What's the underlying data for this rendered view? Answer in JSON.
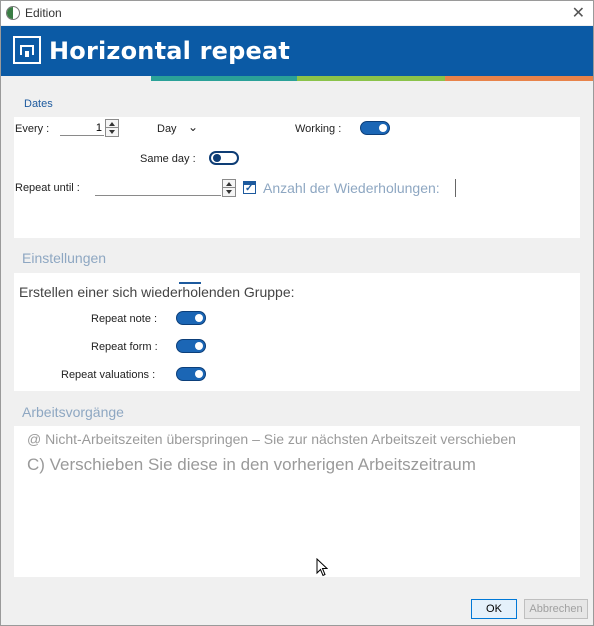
{
  "window": {
    "title": "Edition",
    "close_glyph": "✕"
  },
  "banner": {
    "title": "Horizontal repeat",
    "logo_icon": "frame-logo-icon",
    "color": "#0b5aa5"
  },
  "stripes": [
    "#2aa198",
    "#8bc34a",
    "#9ccc65",
    "#e8834a"
  ],
  "dates": {
    "section_label": "Dates",
    "every_label": "Every :",
    "every_value": "1",
    "unit_value": "Day",
    "unit_chevron": "⌄",
    "working_label": "Working :",
    "same_day_label": "Same day :",
    "repeat_until_label": "Repeat until :",
    "repeat_until_value": "",
    "count_label": "Anzahl der Wiederholungen:",
    "count_checked": true
  },
  "settings": {
    "section_label": "Einstellungen",
    "description": "Erstellen einer sich wiederholenden Gruppe:",
    "repeat_note_label": "Repeat note :",
    "repeat_form_label": "Repeat form :",
    "repeat_valuations_label": "Repeat valuations :"
  },
  "operations": {
    "section_label": "Arbeitsvorgänge",
    "option1": "@ Nicht-Arbeitszeiten überspringen – Sie zur nächsten Arbeitszeit verschieben",
    "option2": "C) Verschieben Sie diese in den vorherigen Arbeitszeitraum"
  },
  "buttons": {
    "ok": "OK",
    "cancel": "Abbrechen"
  }
}
